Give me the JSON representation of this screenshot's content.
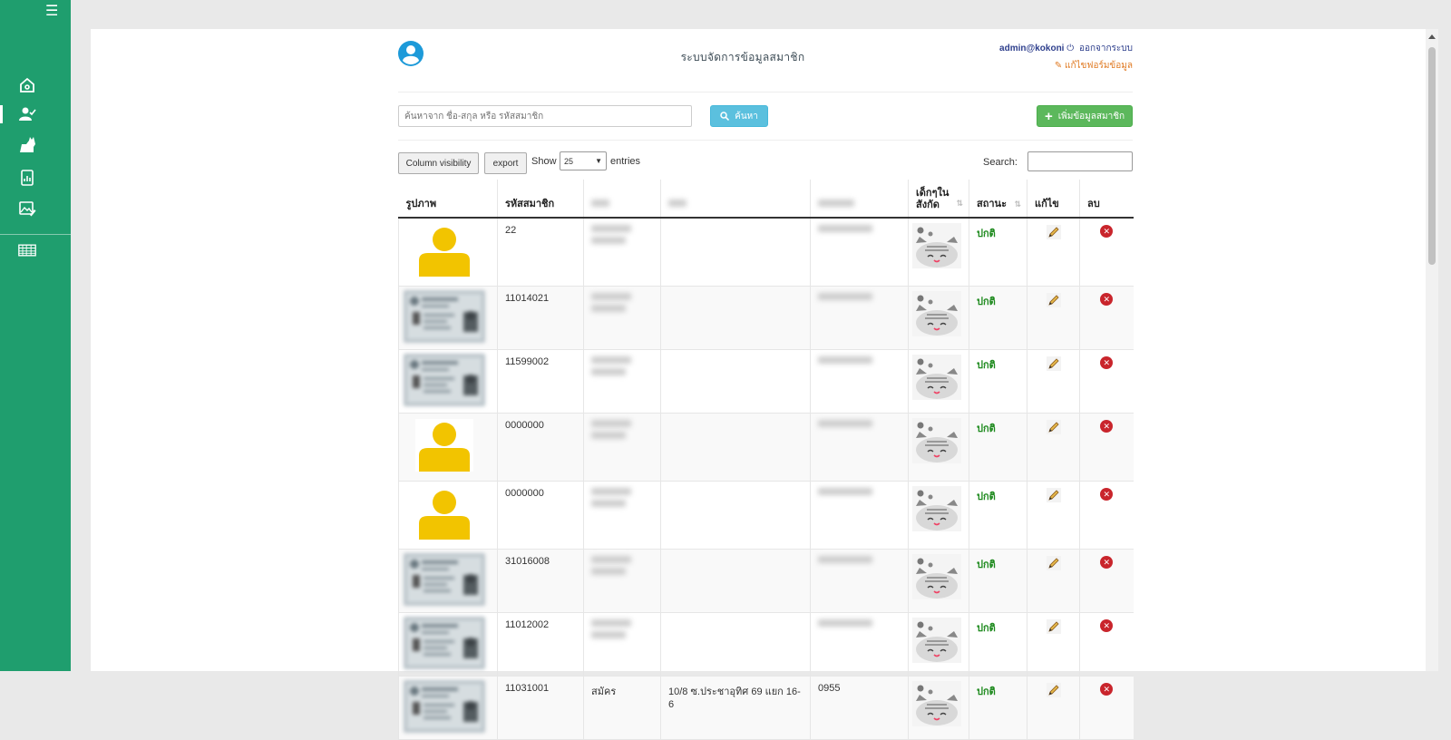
{
  "sidebar": {
    "menu_label": "☰",
    "items": [
      {
        "name": "home-icon"
      },
      {
        "name": "member-icon",
        "active": true
      },
      {
        "name": "cat-icon"
      },
      {
        "name": "report-icon"
      },
      {
        "name": "gallery-edit-icon"
      },
      {
        "name": "table-grid-icon"
      }
    ]
  },
  "header": {
    "title": "ระบบจัดการข้อมูลสมาชิก",
    "user": "admin@kokoni",
    "logout": "ออกจากระบบ",
    "edit_form": "แก้ไขฟอร์มข้อมูล"
  },
  "search": {
    "placeholder": "ค้นหาจาก ชื่อ-สกุล หรือ รหัสสมาชิก",
    "button": "ค้นหา",
    "add_button": "เพิ่มข้อมูลสมาชิก"
  },
  "table_controls": {
    "column_visibility": "Column visibility",
    "export": "export",
    "show": "Show",
    "entries_value": "25",
    "entries": "entries",
    "search_label": "Search:"
  },
  "table": {
    "headers": {
      "photo": "รูปภาพ",
      "member_id": "รหัสสมาชิก",
      "kids": "เด็กๆใน สังกัด",
      "status": "สถานะ",
      "edit": "แก้ไข",
      "delete": "ลบ"
    },
    "rows": [
      {
        "photo": "person",
        "member_id": "22",
        "status": "ปกติ"
      },
      {
        "photo": "idcard",
        "member_id": "11014021",
        "status": "ปกติ"
      },
      {
        "photo": "idcard",
        "member_id": "11599002",
        "status": "ปกติ"
      },
      {
        "photo": "person",
        "member_id": "0000000",
        "status": "ปกติ"
      },
      {
        "photo": "person",
        "member_id": "0000000",
        "status": "ปกติ"
      },
      {
        "photo": "idcard",
        "member_id": "31016008",
        "status": "ปกติ"
      },
      {
        "photo": "idcard",
        "member_id": "11012002",
        "status": "ปกติ"
      },
      {
        "photo": "idcard",
        "member_id": "11031001",
        "col3": "สมัคร",
        "col4": "10/8 ซ.ประชาอุทิศ 69 แยก 16-6",
        "col5": "0955",
        "status": "ปกติ"
      }
    ]
  }
}
